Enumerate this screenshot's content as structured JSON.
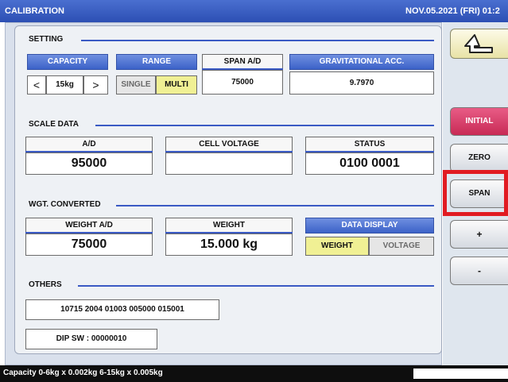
{
  "title_bar": {
    "title": "CALIBRATION",
    "datetime": "NOV.05.2021 (FRI) 01:2"
  },
  "setting": {
    "heading": "SETTING",
    "capacity": {
      "label": "CAPACITY",
      "value": "15kg",
      "prev": "<",
      "next": ">"
    },
    "range": {
      "label": "RANGE",
      "options": [
        "SINGLE",
        "MULTI"
      ],
      "selected": "MULTI"
    },
    "span_ad": {
      "label": "SPAN A/D",
      "value": "75000"
    },
    "grav_acc": {
      "label": "GRAVITATIONAL ACC.",
      "value": "9.7970"
    }
  },
  "scale_data": {
    "heading": "SCALE DATA",
    "ad": {
      "label": "A/D",
      "value": "95000"
    },
    "cell_voltage": {
      "label": "CELL VOLTAGE",
      "value": ""
    },
    "status": {
      "label": "STATUS",
      "value": "0100 0001"
    }
  },
  "wgt_converted": {
    "heading": "WGT. CONVERTED",
    "weight_ad": {
      "label": "WEIGHT A/D",
      "value": "75000"
    },
    "weight": {
      "label": "WEIGHT",
      "value": "15.000 kg"
    },
    "data_display": {
      "label": "DATA DISPLAY",
      "options": [
        "WEIGHT",
        "VOLTAGE"
      ],
      "selected": "WEIGHT"
    }
  },
  "others": {
    "heading": "OTHERS",
    "info": "10715 2004 01003 005000 015001",
    "dip_sw": "DIP SW : 00000010"
  },
  "side_buttons": {
    "back_icon": "back-arrow-icon",
    "initial": "INITIAL",
    "zero": "ZERO",
    "span": "SPAN",
    "plus": "+",
    "minus": "-"
  },
  "status_bar": "Capacity 0-6kg x 0.002kg  6-15kg x 0.005kg",
  "colors": {
    "title_bar": "#2c4fb4",
    "accent_blue": "#3a5ac4",
    "selected_yellow": "#f0f094",
    "initial_red": "#c82a55",
    "highlight_red": "#e11b22"
  }
}
